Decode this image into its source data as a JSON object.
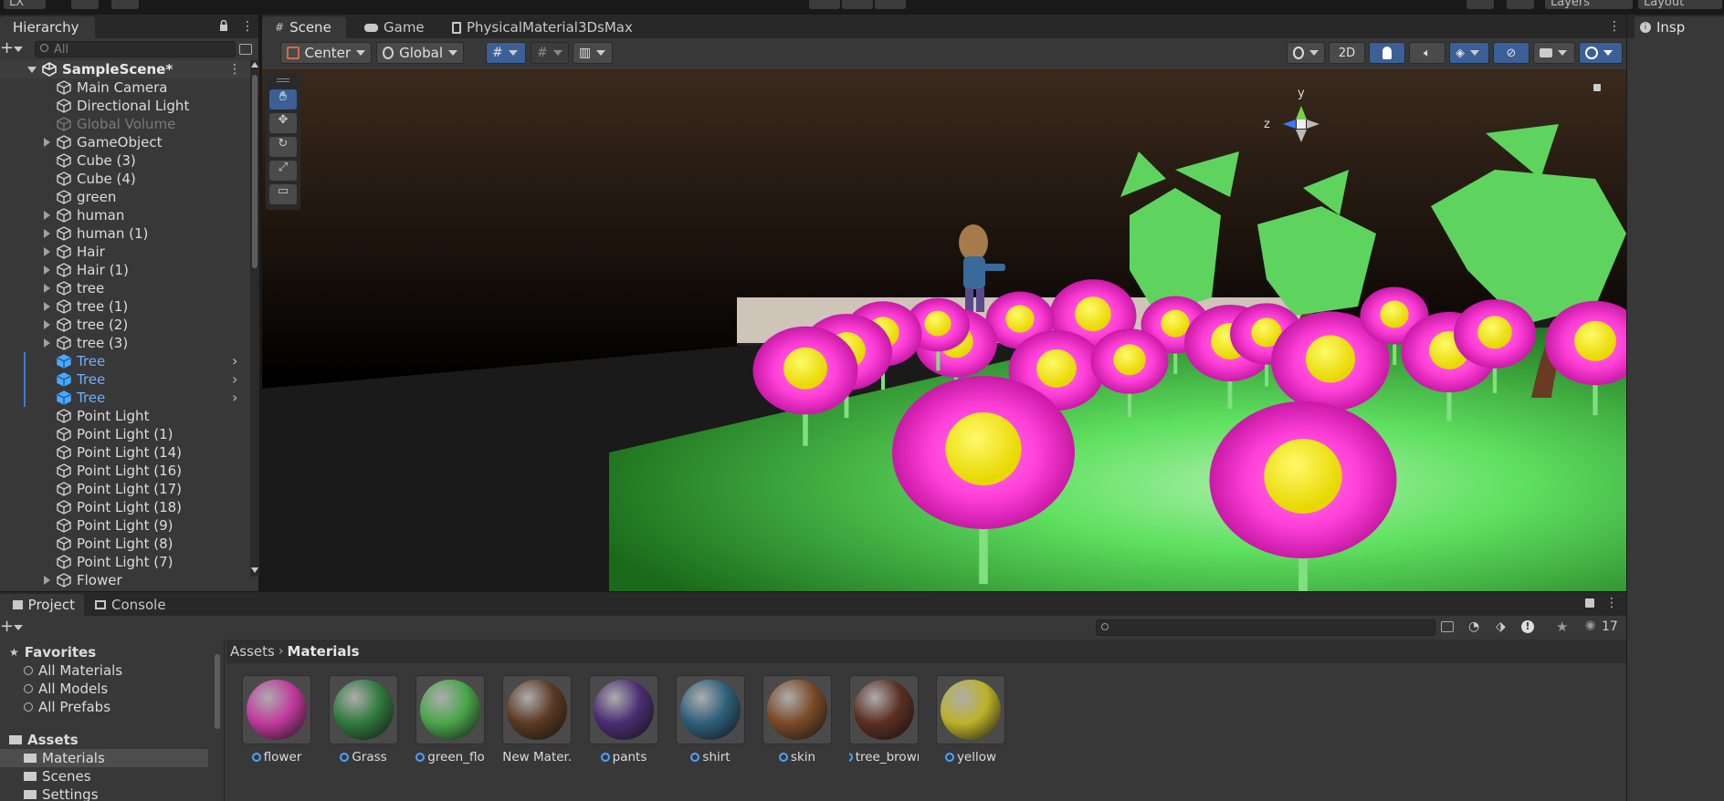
{
  "topbar": {
    "account_label": "LX",
    "layers_label": "Layers",
    "layout_label": "Layout"
  },
  "hierarchy": {
    "tab_label": "Hierarchy",
    "search_placeholder": "All",
    "scene_name": "SampleScene*",
    "items": [
      {
        "label": "Main Camera",
        "state": "normal",
        "expandable": false
      },
      {
        "label": "Directional Light",
        "state": "normal",
        "expandable": false
      },
      {
        "label": "Global Volume",
        "state": "disabled",
        "expandable": false
      },
      {
        "label": "GameObject",
        "state": "normal",
        "expandable": true
      },
      {
        "label": "Cube (3)",
        "state": "normal",
        "expandable": false
      },
      {
        "label": "Cube (4)",
        "state": "normal",
        "expandable": false
      },
      {
        "label": "green",
        "state": "normal",
        "expandable": false
      },
      {
        "label": "human",
        "state": "normal",
        "expandable": true
      },
      {
        "label": "human (1)",
        "state": "normal",
        "expandable": true
      },
      {
        "label": "Hair",
        "state": "normal",
        "expandable": true
      },
      {
        "label": "Hair (1)",
        "state": "normal",
        "expandable": true
      },
      {
        "label": "tree",
        "state": "normal",
        "expandable": true
      },
      {
        "label": "tree (1)",
        "state": "normal",
        "expandable": true
      },
      {
        "label": "tree (2)",
        "state": "normal",
        "expandable": true
      },
      {
        "label": "tree (3)",
        "state": "normal",
        "expandable": true
      },
      {
        "label": "Tree",
        "state": "prefab",
        "expandable": false
      },
      {
        "label": "Tree",
        "state": "prefab",
        "expandable": false
      },
      {
        "label": "Tree",
        "state": "prefab",
        "expandable": false
      },
      {
        "label": "Point Light",
        "state": "normal",
        "expandable": false
      },
      {
        "label": "Point Light (1)",
        "state": "normal",
        "expandable": false
      },
      {
        "label": "Point Light (14)",
        "state": "normal",
        "expandable": false
      },
      {
        "label": "Point Light (16)",
        "state": "normal",
        "expandable": false
      },
      {
        "label": "Point Light (17)",
        "state": "normal",
        "expandable": false
      },
      {
        "label": "Point Light (18)",
        "state": "normal",
        "expandable": false
      },
      {
        "label": "Point Light (9)",
        "state": "normal",
        "expandable": false
      },
      {
        "label": "Point Light (8)",
        "state": "normal",
        "expandable": false
      },
      {
        "label": "Point Light (7)",
        "state": "normal",
        "expandable": false
      },
      {
        "label": "Flower",
        "state": "normal",
        "expandable": true
      }
    ]
  },
  "scene": {
    "tabs": [
      {
        "label": "Scene",
        "active": true
      },
      {
        "label": "Game",
        "active": false
      },
      {
        "label": "PhysicalMaterial3DsMax",
        "active": false
      }
    ],
    "pivot_label": "Center",
    "space_label": "Global",
    "mode_2d_label": "2D",
    "gizmo_axes": {
      "y": "y",
      "z": "z"
    }
  },
  "inspector": {
    "tab_label": "Insp"
  },
  "project": {
    "tabs": [
      {
        "label": "Project",
        "active": true
      },
      {
        "label": "Console",
        "active": false
      }
    ],
    "favorites_label": "Favorites",
    "favorites": [
      "All Materials",
      "All Models",
      "All Prefabs"
    ],
    "assets_label": "Assets",
    "folders": [
      "Materials",
      "Scenes",
      "Settings"
    ],
    "selected_folder": "Materials",
    "breadcrumb": [
      "Assets",
      "Materials"
    ],
    "visible_count": "17",
    "materials": [
      {
        "label": "flower",
        "color": "#c03a9c",
        "dot": "ring"
      },
      {
        "label": "Grass",
        "color": "#2f7a3e",
        "dot": "ring"
      },
      {
        "label": "green_flo",
        "color": "#4aa54a",
        "dot": "ring"
      },
      {
        "label": "New Mater...",
        "color": "#5a3a22",
        "dot": "small"
      },
      {
        "label": "pants",
        "color": "#4a2d72",
        "dot": "ring"
      },
      {
        "label": "shirt",
        "color": "#2e5f7a",
        "dot": "ring"
      },
      {
        "label": "skin",
        "color": "#7a4a26",
        "dot": "ring"
      },
      {
        "label": "tree_brown",
        "color": "#5a2f22",
        "dot": "ring"
      },
      {
        "label": "yellow",
        "color": "#bcb22a",
        "dot": "ring"
      }
    ]
  },
  "colors": {
    "panel_bg": "#383838",
    "tab_bg": "#282828",
    "selection": "#2c5d87",
    "prefab_text": "#6fb0ff",
    "accent_blue": "#3b5f96"
  }
}
